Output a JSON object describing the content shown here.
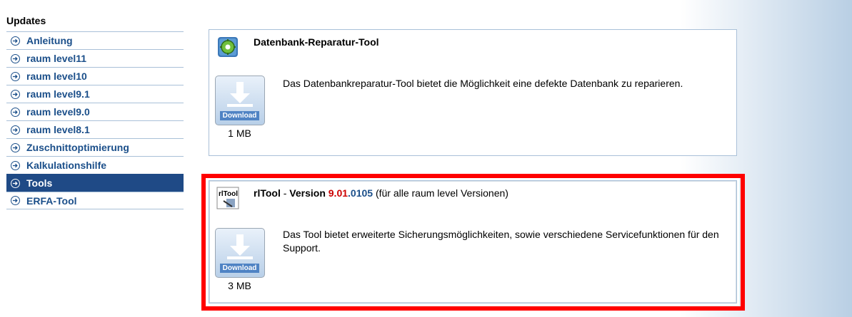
{
  "sidebar": {
    "title": "Updates",
    "items": [
      {
        "label": "Anleitung",
        "active": false
      },
      {
        "label": "raum level11",
        "active": false
      },
      {
        "label": "raum level10",
        "active": false
      },
      {
        "label": "raum level9.1",
        "active": false
      },
      {
        "label": "raum level9.0",
        "active": false
      },
      {
        "label": "raum level8.1",
        "active": false
      },
      {
        "label": "Zuschnittoptimierung",
        "active": false
      },
      {
        "label": "Kalkulationshilfe",
        "active": false
      },
      {
        "label": "Tools",
        "active": true
      },
      {
        "label": "ERFA-Tool",
        "active": false
      }
    ]
  },
  "cards": [
    {
      "title": "Datenbank-Reparatur-Tool",
      "description": "Das Datenbankreparatur-Tool bietet die Möglichkeit eine defekte Datenbank zu reparieren.",
      "download_label": "Download",
      "size": "1 MB",
      "icon": "database-repair-icon"
    },
    {
      "title": "rlTool",
      "title_sep": " - ",
      "version_prefix": "Version ",
      "version_major": "9.01",
      "version_dot": ".",
      "version_build": "0105",
      "version_note": " (für alle raum level Versionen)",
      "description": "Das Tool bietet erweiterte Sicherungsmöglichkeiten, sowie verschiedene Servicefunktionen für den Support.",
      "download_label": "Download",
      "size": "3 MB",
      "icon": "rltool-icon",
      "icon_text": "rlTool"
    }
  ],
  "colors": {
    "nav_text": "#1b4f8a",
    "nav_active_bg": "#1f4a86",
    "highlight": "#ff0000",
    "version_red": "#cc0000"
  }
}
